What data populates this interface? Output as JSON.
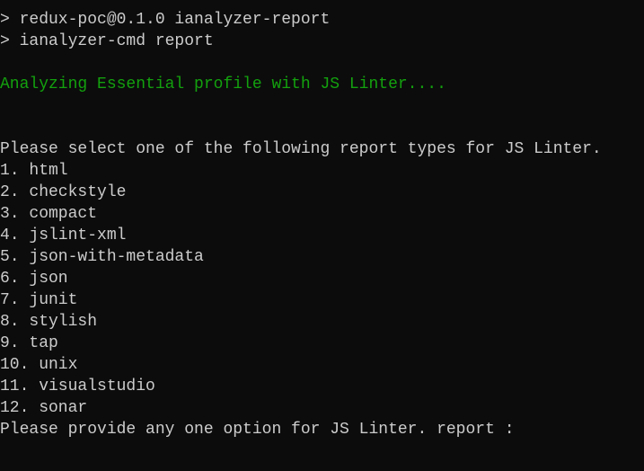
{
  "colors": {
    "background": "#0c0c0c",
    "text": "#cccccc",
    "accent_green": "#13a10e"
  },
  "terminal": {
    "command_lines": [
      "> redux-poc@0.1.0 ianalyzer-report",
      "> ianalyzer-cmd report"
    ],
    "status": "Analyzing Essential profile with JS Linter....",
    "prompt_header": "Please select one of the following report types for JS Linter.",
    "options": [
      "1. html",
      "2. checkstyle",
      "3. compact",
      "4. jslint-xml",
      "5. json-with-metadata",
      "6. json",
      "7. junit",
      "8. stylish",
      "9. tap",
      "10. unix",
      "11. visualstudio",
      "12. sonar"
    ],
    "input_prompt": "Please provide any one option for JS Linter. report : "
  }
}
